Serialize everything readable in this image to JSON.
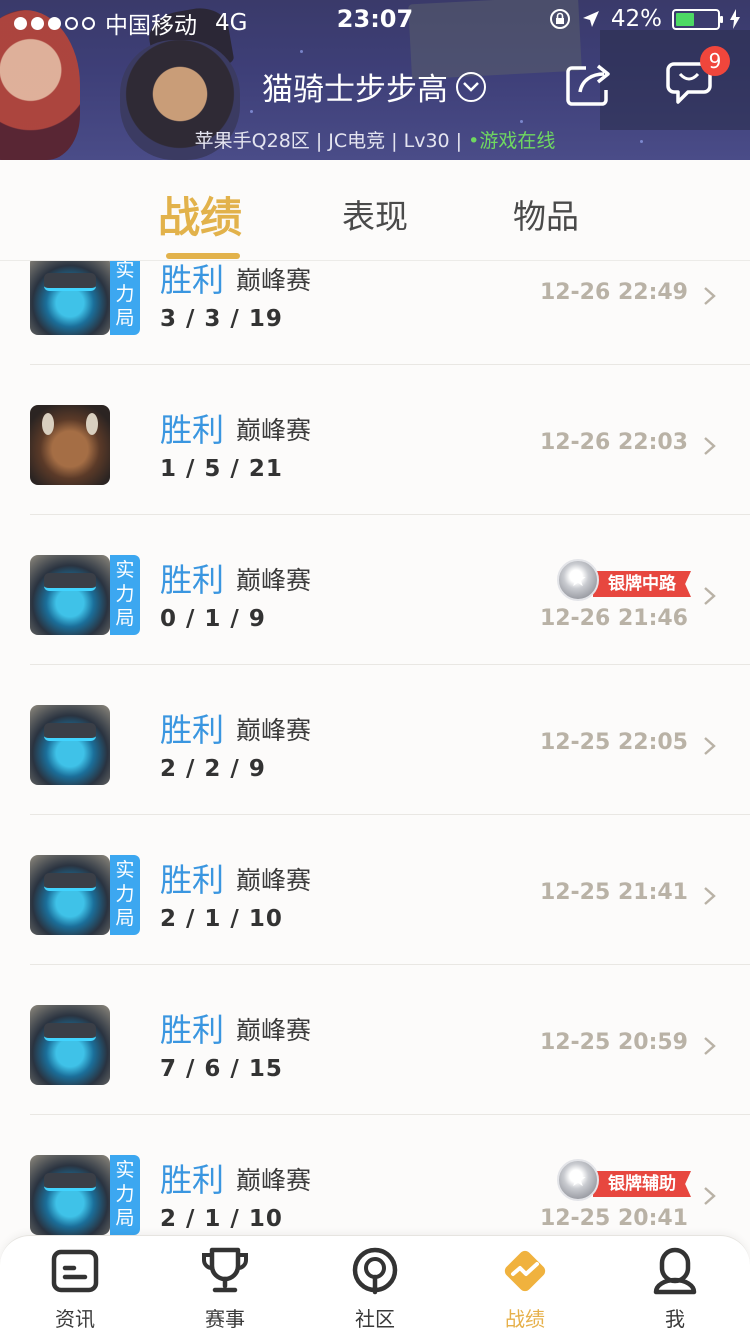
{
  "status_bar": {
    "carrier": "中国移动",
    "network": "4G",
    "time": "23:07",
    "battery": "42%",
    "battery_level": 0.42,
    "icons": [
      "signal-dots",
      "lock-rotation-icon",
      "location-arrow-icon",
      "battery-icon",
      "charging-icon"
    ]
  },
  "header": {
    "player_name": "猫骑士步步高",
    "server_info": "苹果手Q28区 | JC电竞 | Lv30 | ",
    "online_status": "•游戏在线",
    "message_badge": "9"
  },
  "tabs": [
    {
      "label": "战绩",
      "active": true
    },
    {
      "label": "表现",
      "active": false
    },
    {
      "label": "物品",
      "active": false
    }
  ],
  "matches": [
    {
      "result": "胜利",
      "mode": "巅峰赛",
      "kda": "3 / 3 / 19",
      "time": "12-26 22:49",
      "strength": "实力局",
      "hero": "mecha-hero"
    },
    {
      "result": "胜利",
      "mode": "巅峰赛",
      "kda": "1 / 5 / 21",
      "time": "12-26 22:03",
      "strength": null,
      "hero": "beast-hero"
    },
    {
      "result": "胜利",
      "mode": "巅峰赛",
      "kda": "0 / 1 / 9",
      "time": "12-26 21:46",
      "strength": "实力局",
      "hero": "mecha-hero",
      "medal": "银牌中路"
    },
    {
      "result": "胜利",
      "mode": "巅峰赛",
      "kda": "2 / 2 / 9",
      "time": "12-25 22:05",
      "strength": null,
      "hero": "mecha-hero"
    },
    {
      "result": "胜利",
      "mode": "巅峰赛",
      "kda": "2 / 1 / 10",
      "time": "12-25 21:41",
      "strength": "实力局",
      "hero": "mecha-hero"
    },
    {
      "result": "胜利",
      "mode": "巅峰赛",
      "kda": "7 / 6 / 15",
      "time": "12-25 20:59",
      "strength": null,
      "hero": "mecha-hero"
    },
    {
      "result": "胜利",
      "mode": "巅峰赛",
      "kda": "2 / 1 / 10",
      "time": "12-25 20:41",
      "strength": "实力局",
      "hero": "mecha-hero",
      "medal": "银牌辅助"
    }
  ],
  "bottom_nav": [
    {
      "label": "资讯",
      "icon": "news-icon",
      "active": false
    },
    {
      "label": "赛事",
      "icon": "trophy-icon",
      "active": false
    },
    {
      "label": "社区",
      "icon": "community-icon",
      "active": false
    },
    {
      "label": "战绩",
      "icon": "stats-icon",
      "active": true
    },
    {
      "label": "我",
      "icon": "profile-icon",
      "active": false
    }
  ],
  "colors": {
    "accent": "#e2b24b",
    "win": "#3a96e0",
    "strength_tag": "#3ca7f0",
    "medal_ribbon": "#e7473f",
    "online": "#6fd860",
    "badge": "#f0463c"
  }
}
